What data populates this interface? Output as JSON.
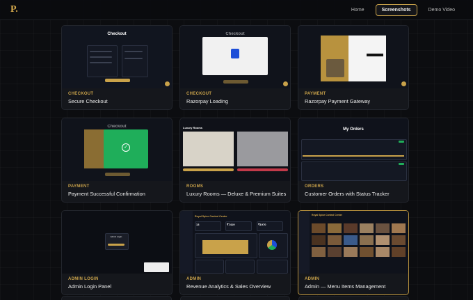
{
  "brand": {
    "logo": "P."
  },
  "nav": {
    "home": "Home",
    "screenshots": "Screenshots",
    "demo": "Demo Video"
  },
  "thumb_text": {
    "checkout": "Checkout",
    "my_orders": "My Orders",
    "admin_login": "Admin Login",
    "control_center": "Royal Spice Control Center",
    "luxury_rooms": "Luxury Rooms",
    "stat_1": "13",
    "stat_2": "₹7419",
    "stat_3": "₹1970"
  },
  "cards": [
    {
      "category": "CHECKOUT",
      "title": "Secure Checkout"
    },
    {
      "category": "CHECKOUT",
      "title": "Razorpay Loading"
    },
    {
      "category": "PAYMENT",
      "title": "Razorpay Payment Gateway"
    },
    {
      "category": "PAYMENT",
      "title": "Payment Successful Confirmation"
    },
    {
      "category": "ROOMS",
      "title": "Luxury Rooms — Deluxe & Premium Suites"
    },
    {
      "category": "ORDERS",
      "title": "Customer Orders with Status Tracker"
    },
    {
      "category": "ADMIN LOGIN",
      "title": "Admin Login Panel"
    },
    {
      "category": "ADMIN",
      "title": "Revenue Analytics & Sales Overview"
    },
    {
      "category": "ADMIN",
      "title": "Admin — Menu Items Management"
    }
  ],
  "colors": {
    "accent": "#c9a24a",
    "background": "#0c0d10",
    "card": "#15171c",
    "success": "#1fae5a",
    "razorpay": "#1d4ed8"
  }
}
